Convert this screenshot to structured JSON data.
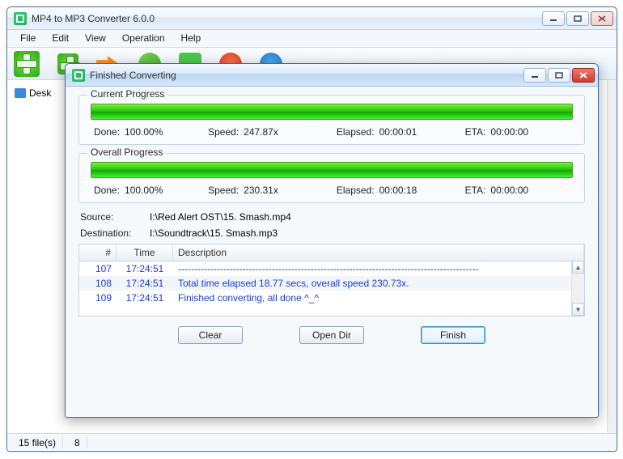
{
  "app": {
    "title": "MP4 to MP3 Converter 6.0.0"
  },
  "menu": [
    "File",
    "Edit",
    "View",
    "Operation",
    "Help"
  ],
  "tree": {
    "item1": "Desk"
  },
  "status": {
    "files": "15 file(s)",
    "sel": "8"
  },
  "dialog": {
    "title": "Finished Converting",
    "current": {
      "label": "Current Progress",
      "done_lbl": "Done:",
      "done_val": "100.00%",
      "speed_lbl": "Speed:",
      "speed_val": "247.87x",
      "elapsed_lbl": "Elapsed:",
      "elapsed_val": "00:00:01",
      "eta_lbl": "ETA:",
      "eta_val": "00:00:00",
      "pct": 100
    },
    "overall": {
      "label": "Overall Progress",
      "done_lbl": "Done:",
      "done_val": "100.00%",
      "speed_lbl": "Speed:",
      "speed_val": "230.31x",
      "elapsed_lbl": "Elapsed:",
      "elapsed_val": "00:00:18",
      "eta_lbl": "ETA:",
      "eta_val": "00:00:00",
      "pct": 100
    },
    "source_lbl": "Source:",
    "source_val": "I:\\Red Alert OST\\15. Smash.mp4",
    "dest_lbl": "Destination:",
    "dest_val": "I:\\Soundtrack\\15. Smash.mp3",
    "log_headers": {
      "num": "#",
      "time": "Time",
      "desc": "Description"
    },
    "log": [
      {
        "n": "107",
        "t": "17:24:51",
        "d": "---------------------------------------------------------------------------------------------"
      },
      {
        "n": "108",
        "t": "17:24:51",
        "d": "Total time elapsed 18.77 secs, overall speed 230.73x."
      },
      {
        "n": "109",
        "t": "17:24:51",
        "d": "Finished converting, all done ^_^"
      }
    ],
    "buttons": {
      "clear": "Clear",
      "opendir": "Open Dir",
      "finish": "Finish"
    }
  }
}
